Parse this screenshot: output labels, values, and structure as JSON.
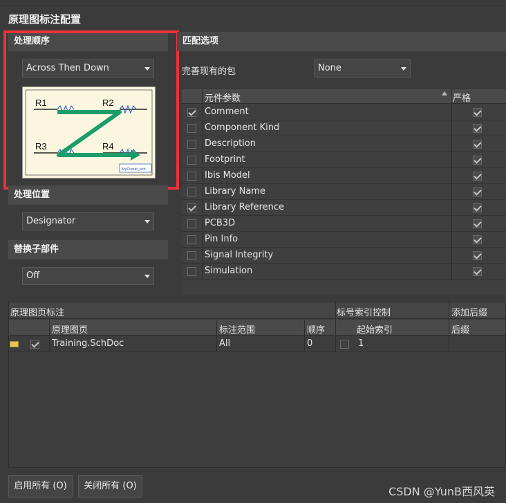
{
  "dialog": {
    "title": "原理图标注配置"
  },
  "order": {
    "header": "处理顺序",
    "selected": "Across Then Down",
    "preview": {
      "labels": [
        "R1",
        "R2",
        "R3",
        "R4"
      ],
      "watermark_text": "MyCircuit_sch",
      "arrow_color": "#1a9d6b",
      "resistor_color": "#3a66c4"
    }
  },
  "location": {
    "header": "处理位置",
    "selected": "Designator"
  },
  "replace": {
    "header": "替换子部件",
    "selected": "Off"
  },
  "match": {
    "header": "匹配选项",
    "complete_label": "完善现有的包",
    "complete_value": "None",
    "columns": {
      "param": "元件参数",
      "strict": "严格"
    },
    "rows": [
      {
        "name": "Comment",
        "checked": true,
        "strict": true
      },
      {
        "name": "Component Kind",
        "checked": false,
        "strict": true
      },
      {
        "name": "Description",
        "checked": false,
        "strict": true
      },
      {
        "name": "Footprint",
        "checked": false,
        "strict": true
      },
      {
        "name": "Ibis Model",
        "checked": false,
        "strict": true
      },
      {
        "name": "Library Name",
        "checked": false,
        "strict": true
      },
      {
        "name": "Library Reference",
        "checked": true,
        "strict": true
      },
      {
        "name": "PCB3D",
        "checked": false,
        "strict": true
      },
      {
        "name": "Pin Info",
        "checked": false,
        "strict": true
      },
      {
        "name": "Signal Integrity",
        "checked": false,
        "strict": true
      },
      {
        "name": "Simulation",
        "checked": false,
        "strict": true
      }
    ]
  },
  "sheets": {
    "group_header": "原理图页标注",
    "index_group_header": "标号索引控制",
    "suffix_group_header": "添加后缀",
    "columns": {
      "sheet": "原理图页",
      "scope": "标注范围",
      "order": "顺序",
      "start_index": "起始索引",
      "suffix": "后缀"
    },
    "rows": [
      {
        "sheet": "Training.SchDoc",
        "scope": "All",
        "order": "0",
        "start_index": "1",
        "suffix": "",
        "enabled": true,
        "index_checked": false
      }
    ]
  },
  "buttons": {
    "enable_all": "启用所有 (O)",
    "disable_all": "关闭所有 (O)"
  },
  "watermark": "CSDN @YunB西风英"
}
